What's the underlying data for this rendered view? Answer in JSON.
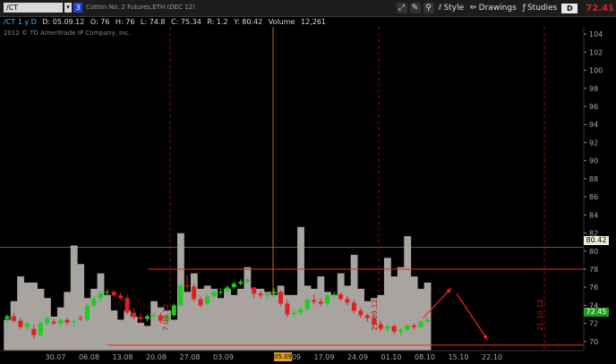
{
  "toolbar": {
    "symbol": "/CT",
    "symbol_dropdown_icon": "caret-down",
    "group_badge": "3",
    "description": "Cotton No. 2 Futures,ETH (DEC 12)",
    "style_label": "Style",
    "drawings_label": "Drawings",
    "studies_label": "Studies",
    "timeframe_box": "D",
    "last_price": "72.41"
  },
  "quote": {
    "study_label": "/CT 1 y D",
    "date": "D: 05.09.12",
    "open": "O: 76",
    "high": "H: 76",
    "low": "L: 74.8",
    "close": "C: 75.34",
    "range": "R: 1.2",
    "y": "Y: 80.42",
    "volume_label": "Volume",
    "volume_value": "12,261"
  },
  "copyright": "2012 © TD Ameritrade IP Company, Inc.",
  "badges": {
    "price_high": "80.42",
    "price_last": "72.45",
    "date_cursor": "05.09"
  },
  "annotations": [
    "7.09.12",
    "21.09.12",
    "21.10.12"
  ],
  "colors": {
    "up": "#20cc20",
    "down": "#e02020",
    "volume": "#a8a4a0",
    "grid": "#7a1010",
    "cursor": "#b07820",
    "accent_red": "#ff2020"
  },
  "chart_data": {
    "type": "candlestick",
    "yaxis_ticks": [
      104,
      102,
      100,
      98,
      96,
      94,
      92,
      90,
      88,
      86,
      84,
      82,
      80,
      78,
      76,
      74,
      72,
      70
    ],
    "ylim": [
      69.0,
      104.8
    ],
    "xaxis_ticks": [
      "30.07",
      "06.08",
      "13.08",
      "20.08",
      "27.08",
      "03.09",
      "05.09",
      "10.09",
      "17.09",
      "24.09",
      "01.10",
      "08.10",
      "15.10",
      "22.10"
    ],
    "candles": [
      [
        72.5,
        73.0,
        72.0,
        72.8
      ],
      [
        72.8,
        73.2,
        72.1,
        72.3
      ],
      [
        72.3,
        72.6,
        71.4,
        71.6
      ],
      [
        71.6,
        72.2,
        71.2,
        72.0
      ],
      [
        71.4,
        71.9,
        70.3,
        70.7
      ],
      [
        70.7,
        72.2,
        70.5,
        72.0
      ],
      [
        72.0,
        72.8,
        71.8,
        72.6
      ],
      [
        72.2,
        72.5,
        71.8,
        72.0
      ],
      [
        72.0,
        72.6,
        71.6,
        72.4
      ],
      [
        72.4,
        72.6,
        71.8,
        72.1
      ],
      [
        72.1,
        72.4,
        71.6,
        72.2
      ],
      [
        72.6,
        72.9,
        72.3,
        72.5
      ],
      [
        72.4,
        74.2,
        72.2,
        74.0
      ],
      [
        74.0,
        75.0,
        73.8,
        74.8
      ],
      [
        74.8,
        75.6,
        74.4,
        75.3
      ],
      [
        75.4,
        75.8,
        75.0,
        75.5
      ],
      [
        75.5,
        75.7,
        74.9,
        75.1
      ],
      [
        75.1,
        75.4,
        74.6,
        74.8
      ],
      [
        74.8,
        75.2,
        73.0,
        73.2
      ],
      [
        73.2,
        73.7,
        72.4,
        72.7
      ],
      [
        72.7,
        73.1,
        72.0,
        72.5
      ],
      [
        72.5,
        73.0,
        72.2,
        72.8
      ],
      [
        72.8,
        73.3,
        72.4,
        72.9
      ],
      [
        72.9,
        73.2,
        72.0,
        72.3
      ],
      [
        72.3,
        73.0,
        72.1,
        72.9
      ],
      [
        72.9,
        74.2,
        72.7,
        74.0
      ],
      [
        74.0,
        76.3,
        73.9,
        76.2
      ],
      [
        76.2,
        77.3,
        75.6,
        76.1
      ],
      [
        76.1,
        76.4,
        74.4,
        74.7
      ],
      [
        74.7,
        75.0,
        73.8,
        74.0
      ],
      [
        74.2,
        75.2,
        74.0,
        75.0
      ],
      [
        75.0,
        75.7,
        74.9,
        75.5
      ],
      [
        75.5,
        75.9,
        75.2,
        75.5
      ],
      [
        75.6,
        76.2,
        75.4,
        76.0
      ],
      [
        76.0,
        76.6,
        75.8,
        76.4
      ],
      [
        76.4,
        76.9,
        76.2,
        76.6
      ],
      [
        76.6,
        77.0,
        76.4,
        76.9
      ],
      [
        76.0,
        76.0,
        74.8,
        75.3
      ],
      [
        75.3,
        75.6,
        74.8,
        75.1
      ],
      [
        75.1,
        75.5,
        74.6,
        75.3
      ],
      [
        75.3,
        75.9,
        74.8,
        75.5
      ],
      [
        75.5,
        75.7,
        73.9,
        74.2
      ],
      [
        74.2,
        74.6,
        72.7,
        73.0
      ],
      [
        73.0,
        73.5,
        72.6,
        73.2
      ],
      [
        73.2,
        73.9,
        72.9,
        73.6
      ],
      [
        73.6,
        74.9,
        73.4,
        74.6
      ],
      [
        74.6,
        75.2,
        74.1,
        74.4
      ],
      [
        74.4,
        74.8,
        73.9,
        74.2
      ],
      [
        74.2,
        75.3,
        74.0,
        75.1
      ],
      [
        75.1,
        75.5,
        74.8,
        75.2
      ],
      [
        75.2,
        75.4,
        74.5,
        74.7
      ],
      [
        74.7,
        75.1,
        74.0,
        74.3
      ],
      [
        74.3,
        74.6,
        73.1,
        73.4
      ],
      [
        73.4,
        73.7,
        72.6,
        72.9
      ],
      [
        72.9,
        73.1,
        72.2,
        72.6
      ],
      [
        72.6,
        72.9,
        71.6,
        71.9
      ],
      [
        71.9,
        72.3,
        71.1,
        71.4
      ],
      [
        71.4,
        71.9,
        71.0,
        71.7
      ],
      [
        71.7,
        71.9,
        70.8,
        71.1
      ],
      [
        71.1,
        71.5,
        70.6,
        71.3
      ],
      [
        71.3,
        71.9,
        71.2,
        71.8
      ],
      [
        71.8,
        72.0,
        71.3,
        71.6
      ],
      [
        71.6,
        72.3,
        71.5,
        72.2
      ],
      [
        72.2,
        72.7,
        72.0,
        72.4
      ]
    ],
    "volume": [
      0.1,
      0.16,
      0.24,
      0.22,
      0.22,
      0.2,
      0.17,
      0.11,
      0.14,
      0.19,
      0.34,
      0.28,
      0.17,
      0.2,
      0.25,
      0.18,
      0.13,
      0.1,
      0.13,
      0.11,
      0.09,
      0.08,
      0.16,
      0.14,
      0.13,
      0.1,
      0.38,
      0.19,
      0.25,
      0.2,
      0.21,
      0.2,
      0.17,
      0.2,
      0.18,
      0.2,
      0.27,
      0.2,
      0.2,
      0.19,
      0.18,
      0.21,
      0.18,
      0.18,
      0.4,
      0.21,
      0.2,
      0.24,
      0.19,
      0.18,
      0.25,
      0.21,
      0.31,
      0.2,
      0.16,
      0.17,
      0.18,
      0.3,
      0.24,
      0.27,
      0.37,
      0.24,
      0.2,
      0.22
    ],
    "resistance_level": 78.0,
    "support_level": 69.6,
    "projection_arrows": [
      {
        "from": [
          "08.10",
          72.6
        ],
        "to": [
          "15.10",
          75.9
        ]
      },
      {
        "from": [
          "15.10",
          75.3
        ],
        "to": [
          "22.10",
          70.2
        ]
      }
    ]
  }
}
